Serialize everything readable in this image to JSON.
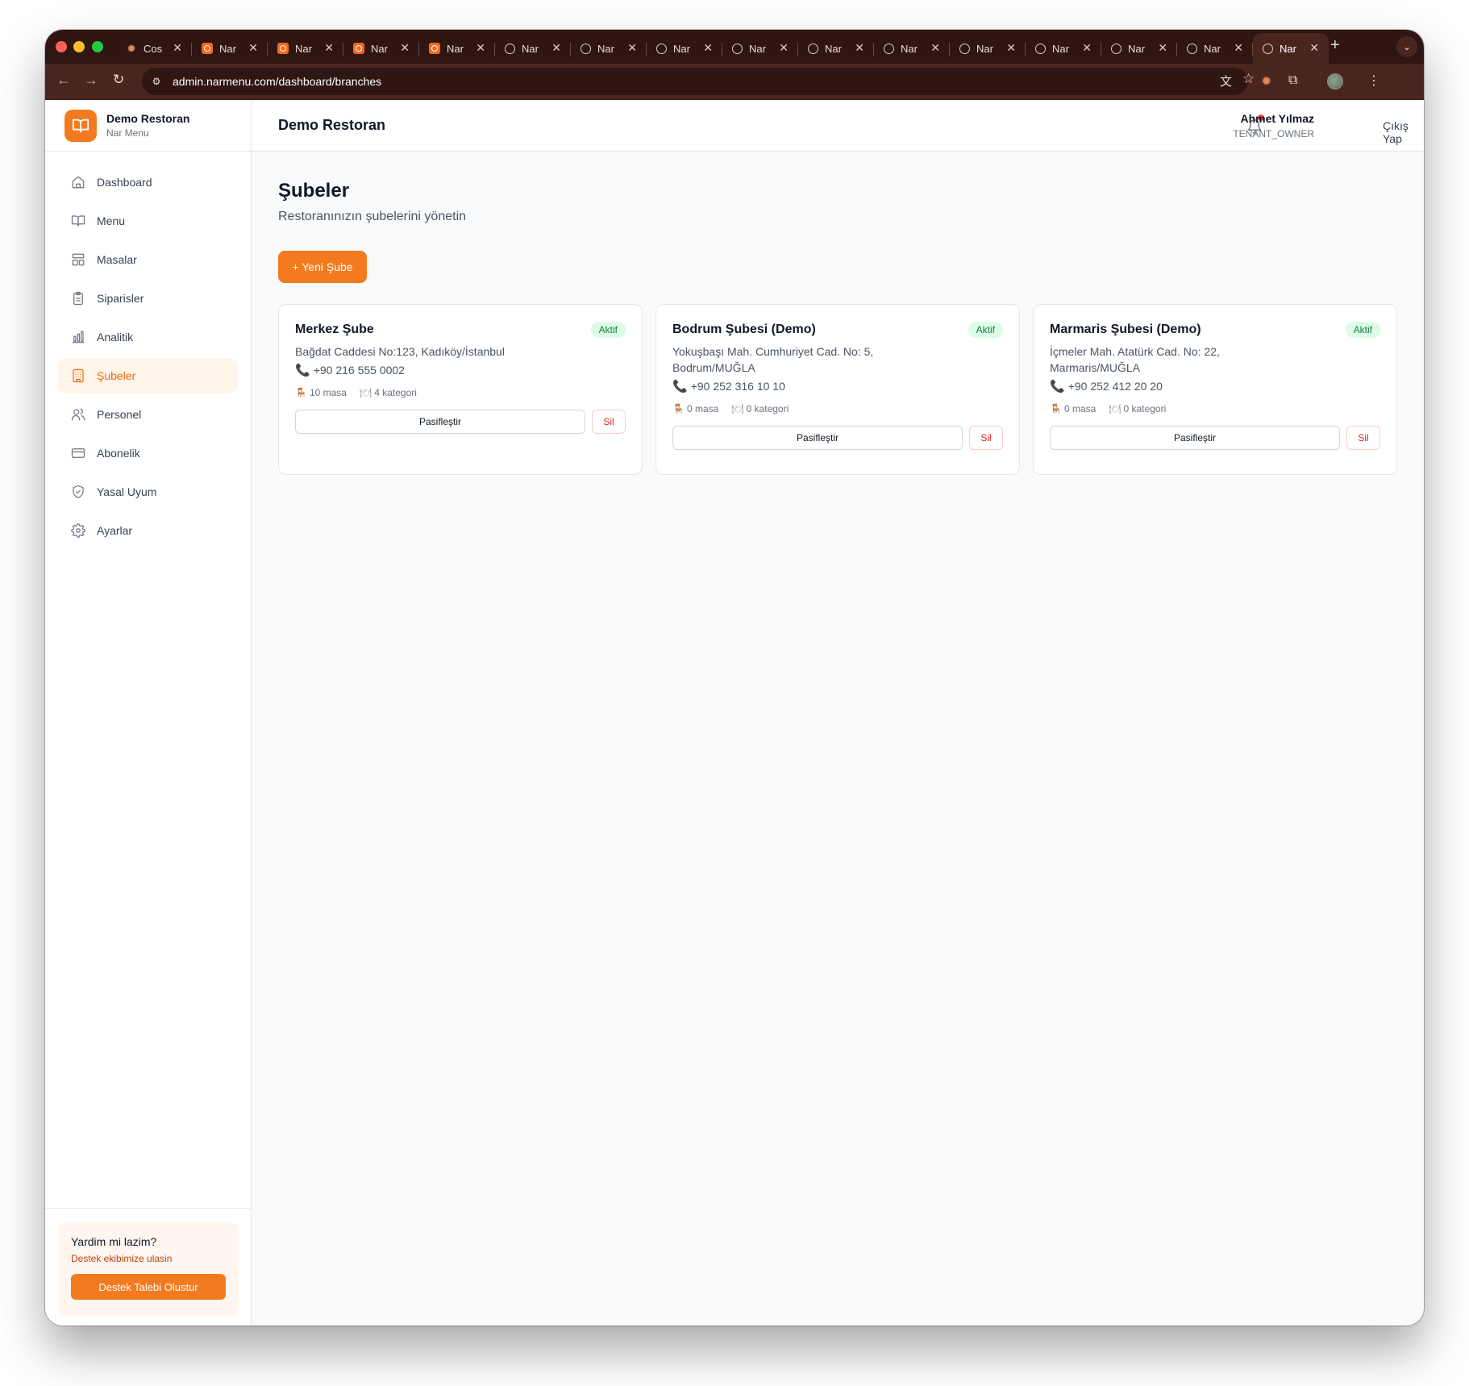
{
  "browser": {
    "tabs": [
      {
        "title": "Cos",
        "icon": "spark-icon",
        "active": false
      },
      {
        "title": "Nar",
        "icon": "nar-icon",
        "active": false
      },
      {
        "title": "Nar",
        "icon": "nar-icon",
        "active": false
      },
      {
        "title": "Nar",
        "icon": "nar-icon",
        "active": false
      },
      {
        "title": "Nar",
        "icon": "nar-icon",
        "active": false
      },
      {
        "title": "Nar",
        "icon": "globe-icon",
        "active": false
      },
      {
        "title": "Nar",
        "icon": "globe-icon",
        "active": false
      },
      {
        "title": "Nar",
        "icon": "globe-icon",
        "active": false
      },
      {
        "title": "Nar",
        "icon": "globe-icon",
        "active": false
      },
      {
        "title": "Nar",
        "icon": "globe-icon",
        "active": false
      },
      {
        "title": "Nar",
        "icon": "globe-icon",
        "active": false
      },
      {
        "title": "Nar",
        "icon": "globe-icon",
        "active": false
      },
      {
        "title": "Nar",
        "icon": "globe-icon",
        "active": false
      },
      {
        "title": "Nar",
        "icon": "globe-icon",
        "active": false
      },
      {
        "title": "Nar",
        "icon": "globe-icon",
        "active": false
      },
      {
        "title": "Nar",
        "icon": "globe-icon",
        "active": true
      }
    ],
    "url": "admin.narmenu.com/dashboard/branches"
  },
  "brand": {
    "name": "Demo Restoran",
    "subtitle": "Nar Menu",
    "accent": "#f47a1f"
  },
  "sidebar": {
    "items": [
      {
        "label": "Dashboard",
        "icon": "home-icon",
        "active": false
      },
      {
        "label": "Menu",
        "icon": "book-icon",
        "active": false
      },
      {
        "label": "Masalar",
        "icon": "table-icon",
        "active": false
      },
      {
        "label": "Siparisler",
        "icon": "clipboard-icon",
        "active": false
      },
      {
        "label": "Analitik",
        "icon": "bar-chart-icon",
        "active": false
      },
      {
        "label": "Şubeler",
        "icon": "building-icon",
        "active": true
      },
      {
        "label": "Personel",
        "icon": "users-icon",
        "active": false
      },
      {
        "label": "Abonelik",
        "icon": "credit-card-icon",
        "active": false
      },
      {
        "label": "Yasal Uyum",
        "icon": "shield-icon",
        "active": false
      },
      {
        "label": "Ayarlar",
        "icon": "gear-icon",
        "active": false
      }
    ],
    "help": {
      "title": "Yardim mi lazim?",
      "link": "Destek ekibimize ulasin",
      "button": "Destek Talebi Olustur"
    }
  },
  "header": {
    "title": "Demo Restoran",
    "user_name": "Ahmet Yılmaz",
    "user_role": "TENANT_OWNER",
    "logout": "Çıkış Yap"
  },
  "page": {
    "title": "Şubeler",
    "subtitle": "Restoranınızın şubelerini yönetin",
    "new_button": "+ Yeni Şube"
  },
  "branches": [
    {
      "name": "Merkez Şube",
      "status": "Aktif",
      "address": "Bağdat Caddesi No:123, Kadıköy/İstanbul",
      "phone": "+90 216 555 0002",
      "tables": "10 masa",
      "categories": "4 kategori",
      "deactivate": "Pasifleştir",
      "delete": "Sil"
    },
    {
      "name": "Bodrum Şubesi (Demo)",
      "status": "Aktif",
      "address": "Yokuşbaşı Mah. Cumhuriyet Cad. No: 5, Bodrum/MUĞLA",
      "phone": "+90 252 316 10 10",
      "tables": "0 masa",
      "categories": "0 kategori",
      "deactivate": "Pasifleştir",
      "delete": "Sil"
    },
    {
      "name": "Marmaris Şubesi (Demo)",
      "status": "Aktif",
      "address": "İçmeler Mah. Atatürk Cad. No: 22, Marmaris/MUĞLA",
      "phone": "+90 252 412 20 20",
      "tables": "0 masa",
      "categories": "0 kategori",
      "deactivate": "Pasifleştir",
      "delete": "Sil"
    }
  ]
}
